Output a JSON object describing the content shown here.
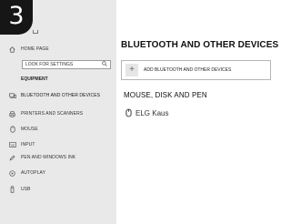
{
  "step_badge": "3",
  "sidebar": {
    "home": {
      "label": "HOME PAGE",
      "icon": "home-icon"
    },
    "search": {
      "placeholder": "LOOK FOR SETTINGS",
      "icon": "search-icon"
    },
    "section_header": "EQUIPMENT",
    "items": [
      {
        "label": "BLUETOOTH AND OTHER DEVICES",
        "icon": "bluetooth-devices-icon",
        "selected": true
      },
      {
        "label": "PRINTERS AND SCANNERS",
        "icon": "printer-icon"
      },
      {
        "label": "MOUSE",
        "icon": "mouse-icon"
      },
      {
        "label": "INPUT",
        "icon": "keyboard-icon"
      },
      {
        "label": "PEN AND WINDOWS INK",
        "icon": "pen-icon"
      },
      {
        "label": "AUTOPLAY",
        "icon": "autoplay-icon"
      },
      {
        "label": "USB",
        "icon": "usb-icon"
      }
    ]
  },
  "main": {
    "title": "BLUETOOTH AND OTHER DEVICES",
    "add_device": {
      "label": "ADD BLUETOOTH AND OTHER DEVICES",
      "icon": "plus-icon"
    },
    "section_title": "MOUSE, DISK AND PEN",
    "devices": [
      {
        "name": "ELG Kaus",
        "icon": "mouse-icon"
      }
    ]
  }
}
